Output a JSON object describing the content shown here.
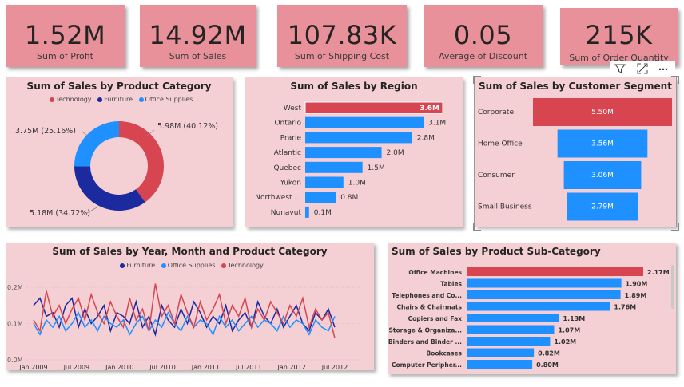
{
  "kpis": [
    {
      "value": "1.52M",
      "label": "Sum of Profit"
    },
    {
      "value": "14.92M",
      "label": "Sum of Sales"
    },
    {
      "value": "107.83K",
      "label": "Sum of Shipping Cost"
    },
    {
      "value": "0.05",
      "label": "Average of Discount"
    },
    {
      "value": "215K",
      "label": "Sum of Order Quantity"
    }
  ],
  "colors": {
    "technology": "#d64550",
    "furniture": "#1b2a9e",
    "office_supplies": "#1e90ff",
    "highlight": "#d64550",
    "bar": "#1e90ff",
    "panel_bg": "#f4cfd4",
    "kpi_bg": "#e8919a"
  },
  "toolbar": {
    "filter_icon": "filter-icon",
    "focus_icon": "focus-mode-icon",
    "more_icon": "more-options-icon"
  },
  "chart_data": [
    {
      "type": "pie",
      "title": "Sum of Sales by Product Category",
      "legend": [
        "Technology",
        "Furniture",
        "Office Supplies"
      ],
      "values": [
        5.98,
        5.18,
        3.75
      ],
      "labels": [
        "5.98M (40.12%)",
        "5.18M (34.72%)",
        "3.75M (25.16%)"
      ],
      "percents": [
        40.12,
        34.72,
        25.16
      ],
      "donut": true
    },
    {
      "type": "bar",
      "orientation": "horizontal",
      "title": "Sum of Sales by Region",
      "categories": [
        "West",
        "Ontario",
        "Prarie",
        "Atlantic",
        "Quebec",
        "Yukon",
        "Northwest ...",
        "Nunavut"
      ],
      "values": [
        3.6,
        3.1,
        2.8,
        2.0,
        1.5,
        1.0,
        0.8,
        0.1
      ],
      "data_labels": [
        "3.6M",
        "3.1M",
        "2.8M",
        "2.0M",
        "1.5M",
        "1.0M",
        "0.8M",
        "0.1M"
      ],
      "highlight_index": 0
    },
    {
      "type": "bar",
      "orientation": "funnel",
      "title": "Sum of Sales by Customer Segment",
      "categories": [
        "Corporate",
        "Home Office",
        "Consumer",
        "Small Business"
      ],
      "values": [
        5.5,
        3.56,
        3.06,
        2.79
      ],
      "data_labels": [
        "5.50M",
        "3.56M",
        "3.06M",
        "2.79M"
      ],
      "highlight_index": 0
    },
    {
      "type": "line",
      "title": "Sum of Sales by Year, Month and Product Category",
      "legend": [
        "Furniture",
        "Office Supplies",
        "Technology"
      ],
      "x_ticks": [
        "Jan 2009",
        "Jul 2009",
        "Jan 2010",
        "Jul 2010",
        "Jan 2011",
        "Jul 2011",
        "Jan 2012",
        "Jul 2012"
      ],
      "y_ticks": [
        "0.0M",
        "0.1M",
        "0.2M"
      ],
      "ylim": [
        0,
        0.2
      ],
      "series": [
        {
          "name": "Furniture",
          "values": [
            0.15,
            0.17,
            0.12,
            0.13,
            0.09,
            0.15,
            0.17,
            0.09,
            0.14,
            0.1,
            0.12,
            0.15,
            0.08,
            0.13,
            0.12,
            0.1,
            0.16,
            0.09,
            0.12,
            0.07,
            0.15,
            0.11,
            0.09,
            0.14,
            0.1,
            0.16,
            0.13,
            0.09,
            0.12,
            0.1,
            0.15,
            0.08,
            0.11,
            0.13,
            0.09,
            0.16,
            0.12,
            0.1,
            0.14,
            0.09,
            0.12,
            0.15,
            0.1,
            0.08,
            0.13,
            0.11,
            0.14,
            0.09
          ]
        },
        {
          "name": "Office Supplies",
          "values": [
            0.1,
            0.07,
            0.11,
            0.09,
            0.12,
            0.08,
            0.1,
            0.13,
            0.09,
            0.11,
            0.08,
            0.12,
            0.1,
            0.09,
            0.11,
            0.07,
            0.1,
            0.12,
            0.08,
            0.11,
            0.09,
            0.13,
            0.1,
            0.08,
            0.12,
            0.09,
            0.11,
            0.1,
            0.07,
            0.12,
            0.09,
            0.11,
            0.08,
            0.1,
            0.12,
            0.09,
            0.11,
            0.1,
            0.08,
            0.12,
            0.09,
            0.11,
            0.1,
            0.07,
            0.11,
            0.09,
            0.08,
            0.12
          ]
        },
        {
          "name": "Technology",
          "values": [
            0.11,
            0.08,
            0.19,
            0.12,
            0.15,
            0.1,
            0.14,
            0.17,
            0.11,
            0.18,
            0.13,
            0.1,
            0.16,
            0.12,
            0.09,
            0.17,
            0.11,
            0.14,
            0.08,
            0.21,
            0.12,
            0.15,
            0.1,
            0.18,
            0.13,
            0.09,
            0.16,
            0.11,
            0.14,
            0.18,
            0.1,
            0.15,
            0.12,
            0.17,
            0.09,
            0.14,
            0.11,
            0.16,
            0.13,
            0.1,
            0.15,
            0.12,
            0.17,
            0.09,
            0.14,
            0.11,
            0.13,
            0.06
          ]
        }
      ]
    },
    {
      "type": "bar",
      "orientation": "horizontal",
      "title": "Sum of Sales by Product Sub-Category",
      "categories": [
        "Office Machines",
        "Tables",
        "Telephones and Co...",
        "Chairs & Chairmats",
        "Copiers and Fax",
        "Storage & Organiza...",
        "Binders and Binder ...",
        "Bookcases",
        "Computer Peripher..."
      ],
      "values": [
        2.17,
        1.9,
        1.89,
        1.76,
        1.13,
        1.07,
        1.02,
        0.82,
        0.8
      ],
      "data_labels": [
        "2.17M",
        "1.90M",
        "1.89M",
        "1.76M",
        "1.13M",
        "1.07M",
        "1.02M",
        "0.82M",
        "0.80M"
      ],
      "highlight_index": 0
    }
  ]
}
